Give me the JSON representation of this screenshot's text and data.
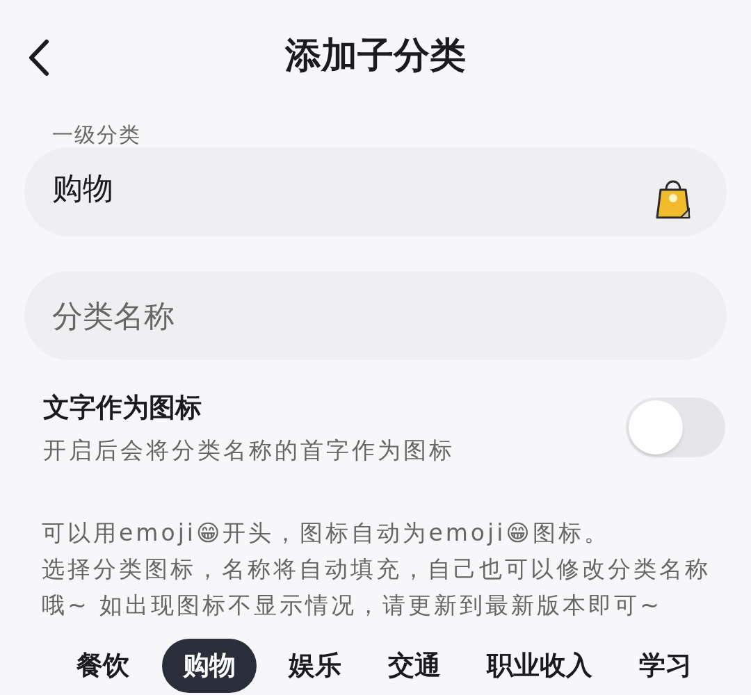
{
  "header": {
    "title": "添加子分类"
  },
  "parent_field": {
    "label": "一级分类",
    "value": "购物"
  },
  "name_field": {
    "placeholder": "分类名称"
  },
  "text_icon_setting": {
    "title": "文字作为图标",
    "description": "开启后会将分类名称的首字作为图标",
    "on": false
  },
  "notes": [
    "可以用emoji😁开头，图标自动为emoji😁图标。",
    "选择分类图标，名称将自动填充，自己也可以修改分类名称哦~ 如出现图标不显示情况，请更新到最新版本即可~"
  ],
  "category_tabs": [
    {
      "label": "餐饮",
      "selected": false
    },
    {
      "label": "购物",
      "selected": true
    },
    {
      "label": "娱乐",
      "selected": false
    },
    {
      "label": "交通",
      "selected": false
    },
    {
      "label": "职业收入",
      "selected": false
    },
    {
      "label": "学习",
      "selected": false
    }
  ]
}
